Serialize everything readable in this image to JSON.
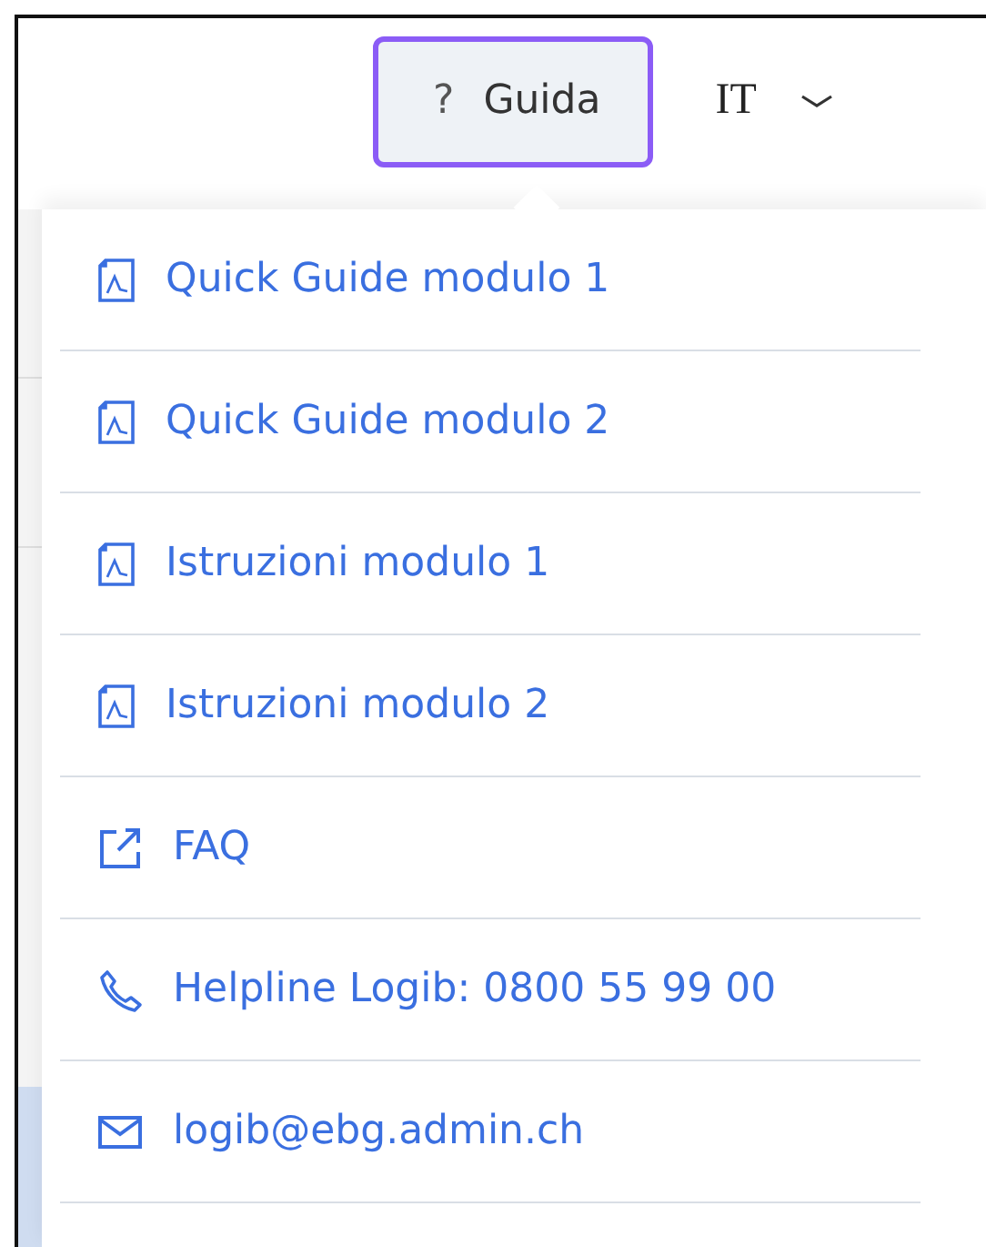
{
  "header": {
    "help_button": {
      "icon": "?",
      "label": "Guida",
      "selected": true
    },
    "language": {
      "label": "IT"
    }
  },
  "help_menu": [
    {
      "kind": "pdf",
      "label": "Quick Guide modulo 1"
    },
    {
      "kind": "pdf",
      "label": "Quick Guide modulo 2"
    },
    {
      "kind": "pdf",
      "label": "Istruzioni modulo 1"
    },
    {
      "kind": "pdf",
      "label": "Istruzioni modulo 2"
    },
    {
      "kind": "external",
      "label": "FAQ"
    },
    {
      "kind": "phone",
      "label": "Helpline Logib: 0800 55 99 00"
    },
    {
      "kind": "mail",
      "label": "logib@ebg.admin.ch"
    }
  ]
}
